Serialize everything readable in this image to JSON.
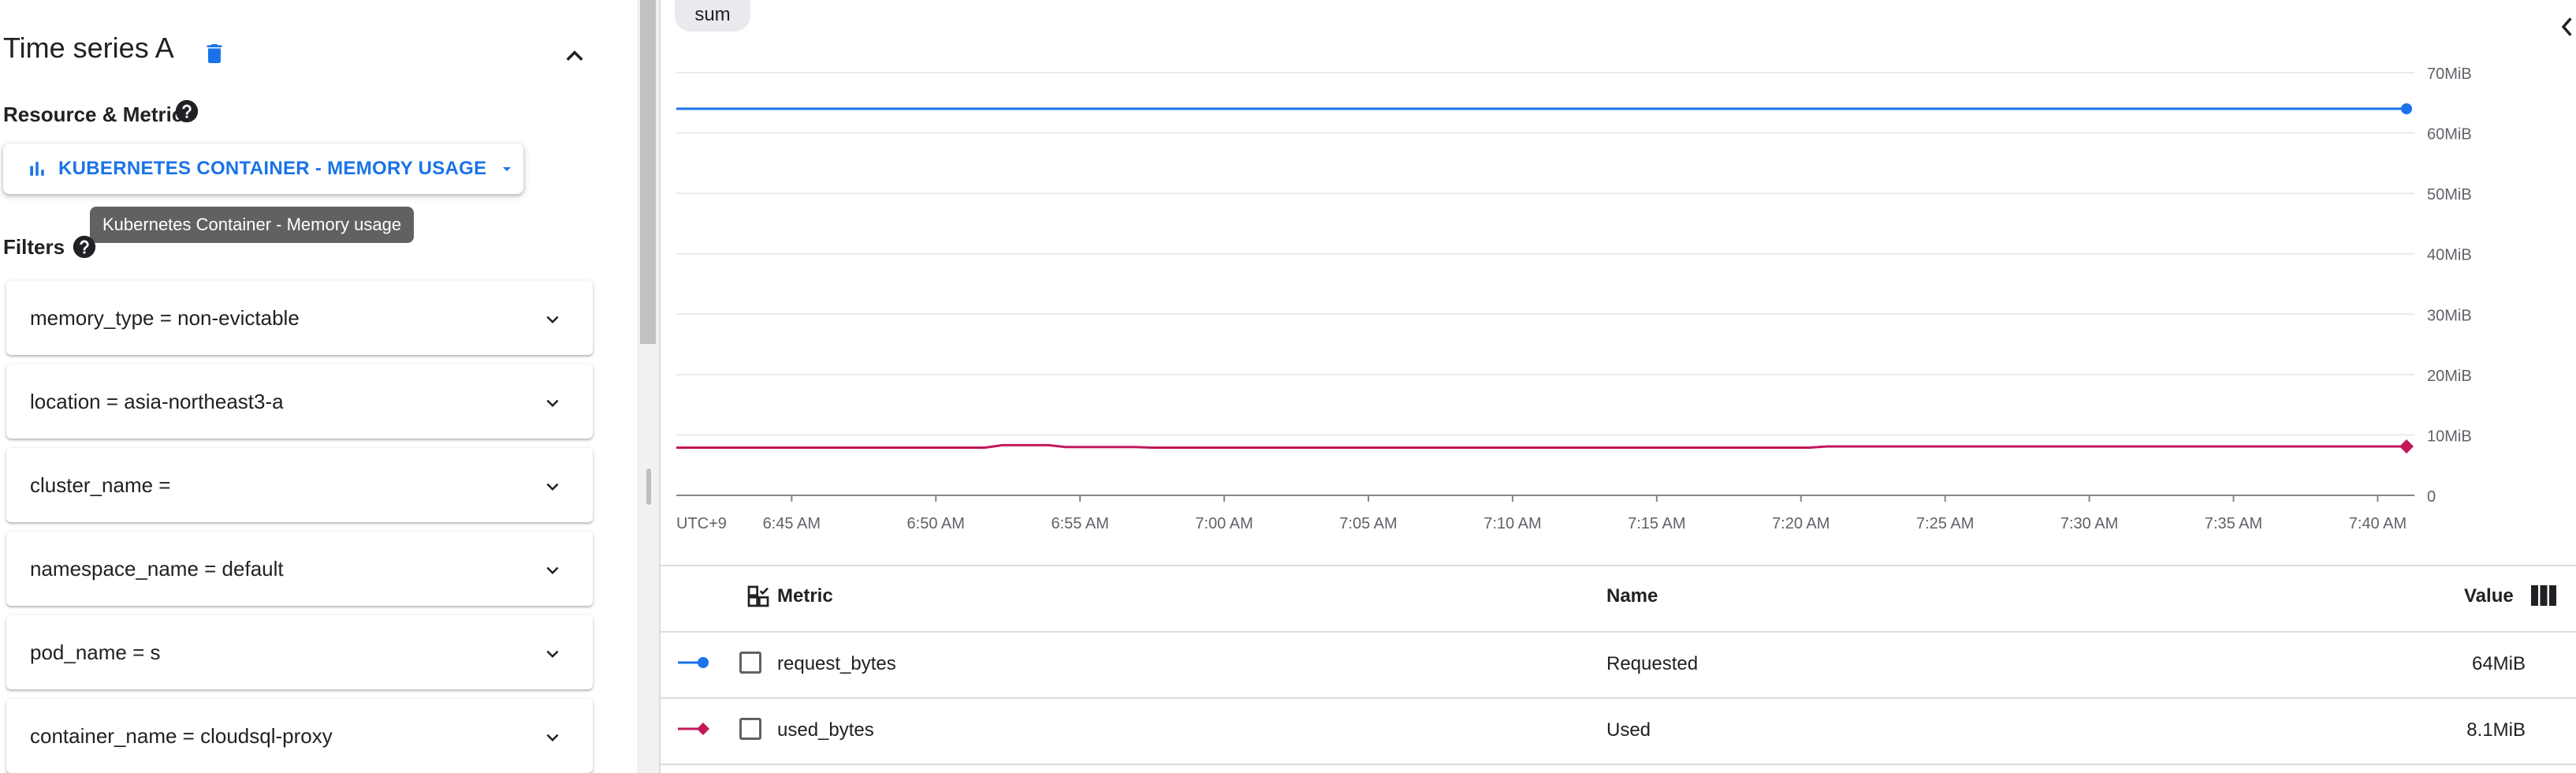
{
  "left": {
    "title": "Time series A",
    "resource_metric_label": "Resource & Metric",
    "metric_button_label": "KUBERNETES CONTAINER - MEMORY USAGE",
    "tooltip": "Kubernetes Container - Memory usage",
    "filters_label": "Filters",
    "filters": [
      "memory_type = non-evictable",
      "location = asia-northeast3-a",
      "cluster_name =",
      "namespace_name = default",
      "pod_name = s",
      "container_name = cloudsql-proxy"
    ]
  },
  "aggregation_chip": "sum",
  "chart_data": {
    "type": "line",
    "timezone_label": "UTC+9",
    "x_ticks": [
      "6:45 AM",
      "6:50 AM",
      "6:55 AM",
      "7:00 AM",
      "7:05 AM",
      "7:10 AM",
      "7:15 AM",
      "7:20 AM",
      "7:25 AM",
      "7:30 AM",
      "7:35 AM",
      "7:40 AM"
    ],
    "x_range_minutes": [
      "6:41 AM",
      "7:41 AM"
    ],
    "y_ticks": [
      "0",
      "10MiB",
      "20MiB",
      "30MiB",
      "40MiB",
      "50MiB",
      "60MiB",
      "70MiB"
    ],
    "ylim": [
      0,
      70
    ],
    "y_unit": "MiB",
    "grid": true,
    "series": [
      {
        "name": "request_bytes",
        "color": "#1a73e8",
        "marker": "circle",
        "x_minutes": [
          0,
          60
        ],
        "values": [
          64,
          64
        ]
      },
      {
        "name": "used_bytes",
        "color": "#c2185b",
        "marker": "diamond",
        "x_minutes": [
          0,
          10.7,
          11.3,
          12.9,
          13.5,
          15.9,
          16.5,
          39.3,
          39.9,
          60
        ],
        "values": [
          7.9,
          7.9,
          8.3,
          8.3,
          8.0,
          8.0,
          7.9,
          7.9,
          8.1,
          8.1
        ]
      }
    ]
  },
  "table": {
    "headers": {
      "metric": "Metric",
      "name": "Name",
      "value": "Value"
    },
    "rows": [
      {
        "metric": "request_bytes",
        "name": "Requested",
        "value": "64MiB",
        "color": "#1a73e8",
        "marker": "circle"
      },
      {
        "metric": "used_bytes",
        "name": "Used",
        "value": "8.1MiB",
        "color": "#c2185b",
        "marker": "diamond"
      }
    ]
  },
  "colors": {
    "accent": "#1a73e8",
    "series_blue": "#1a73e8",
    "series_magenta": "#c2185b"
  },
  "icons": {
    "delete": "trash-icon",
    "collapse": "chevron-up-icon",
    "help": "help-icon",
    "metric": "bar-chart-icon",
    "dropdown": "caret-down-icon",
    "filter_expand": "chevron-down-icon",
    "column_picker": "columns-icon",
    "metric_select": "select-all-icon",
    "side_panel": "chevron-left-icon"
  }
}
